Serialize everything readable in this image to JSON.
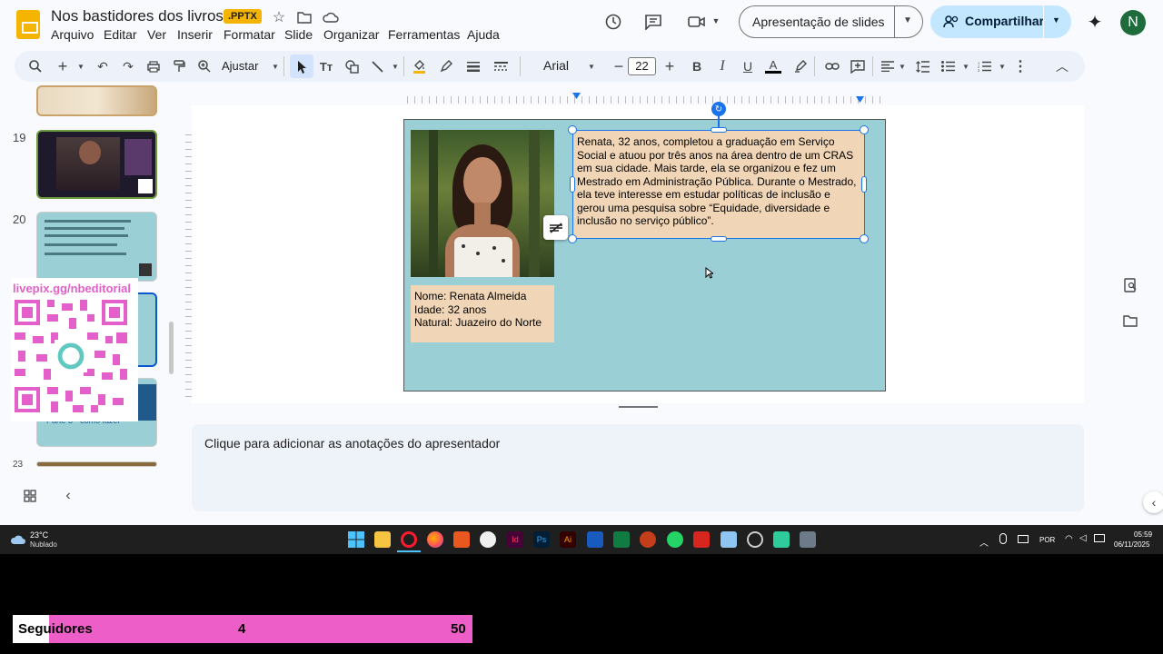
{
  "app": {
    "doc_title": "Nos bastidores dos livros",
    "file_ext": ".PPTX",
    "menus": [
      "Arquivo",
      "Editar",
      "Ver",
      "Inserir",
      "Formatar",
      "Slide",
      "Organizar",
      "Ferramentas",
      "Ajuda"
    ],
    "slideshow_label": "Apresentação de slides",
    "share_label": "Compartilhar",
    "avatar_initial": "N"
  },
  "toolbar": {
    "zoom_label": "Ajustar",
    "font_name": "Arial",
    "font_size": "22"
  },
  "filmstrip": {
    "numbers": [
      "19",
      "20",
      "23"
    ]
  },
  "slide": {
    "info_lines": [
      "Nome: Renata Almeida",
      "Idade: 32 anos",
      "Natural: Juazeiro do Norte"
    ],
    "bio_text": "Renata, 32 anos, completou a graduação em Serviço Social e atuou por três anos na área dentro de um CRAS em sua cidade. Mais tarde, ela se organizou e fez um Mestrado em Administração Pública. Durante o Mestrado, ela teve interesse em estudar políticas de inclusão e gerou uma pesquisa sobre “Equidade, diversidade e inclusão no serviço público”."
  },
  "notes": {
    "placeholder": "Clique para adicionar as anotações do apresentador"
  },
  "overlay": {
    "url": "livepix.gg/nbeditorial",
    "thumb_caption": "Parte 3 - como fazer"
  },
  "taskbar": {
    "temperature": "23°C",
    "weather": "Nublado",
    "lang": "POR",
    "time": "05:59",
    "date": "06/11/2025"
  },
  "followers": {
    "label": "Seguidores",
    "current": "4",
    "goal": "50"
  },
  "colors": {
    "accent": "#1a73e8",
    "slide_bg": "#9bcfd6",
    "box_bg": "#f0d5b6",
    "share_bg": "#c2e7ff",
    "followers_bg": "#ee5ec8"
  }
}
